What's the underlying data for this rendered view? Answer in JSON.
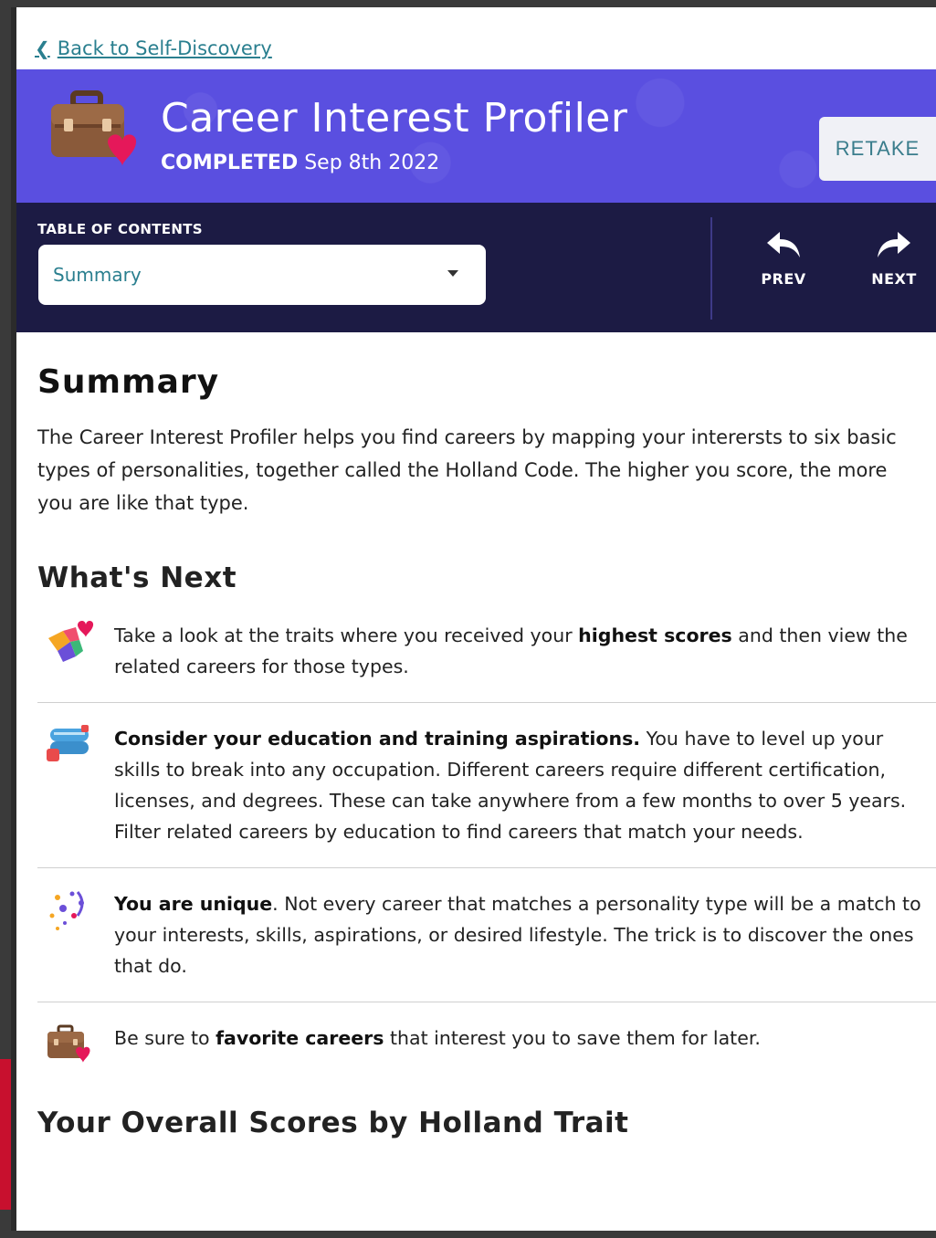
{
  "back_link": {
    "label": "Back to Self-Discovery"
  },
  "hero": {
    "title": "Career Interest Profiler",
    "status": "COMPLETED",
    "date": "Sep 8th 2022",
    "retake_label": "RETAKE",
    "background_color": "#5a4fe0",
    "icon": "briefcase-heart-icon"
  },
  "toc": {
    "label": "TABLE OF CONTENTS",
    "selected": "Summary",
    "prev_label": "PREV",
    "next_label": "NEXT",
    "background_color": "#1c1b44"
  },
  "summary": {
    "title": "Summary",
    "text": "The Career Interest Profiler helps you find careers by mapping your interersts to six basic types of personalities, together called the Holland Code. The higher you score, the more you are like that type."
  },
  "whats_next": {
    "title": "What's Next",
    "items": [
      {
        "icon": "puzzle-heart-icon",
        "pre": "Take a look at the traits where you received your ",
        "bold": "highest scores",
        "post": " and then view the related careers for those types."
      },
      {
        "icon": "diploma-scroll-icon",
        "pre": "",
        "bold": "Consider your education and training aspirations.",
        "post": " You have to level up your skills to break into any occupation. Different careers require different certification, licenses, and degrees. These can take anywhere from a few months to over 5 years. Filter related careers by education to find careers that match your needs."
      },
      {
        "icon": "sparkle-unique-icon",
        "pre": "",
        "bold": "You are unique",
        "post": ". Not every career that matches a personality type will be a match to your interests, skills, aspirations, or desired lifestyle. The trick is to discover the ones that do."
      },
      {
        "icon": "briefcase-heart-icon",
        "pre": "Be sure to ",
        "bold": "favorite careers",
        "post": " that interest you to save them for later."
      }
    ]
  },
  "scores": {
    "title": "Your Overall Scores by Holland Trait"
  }
}
